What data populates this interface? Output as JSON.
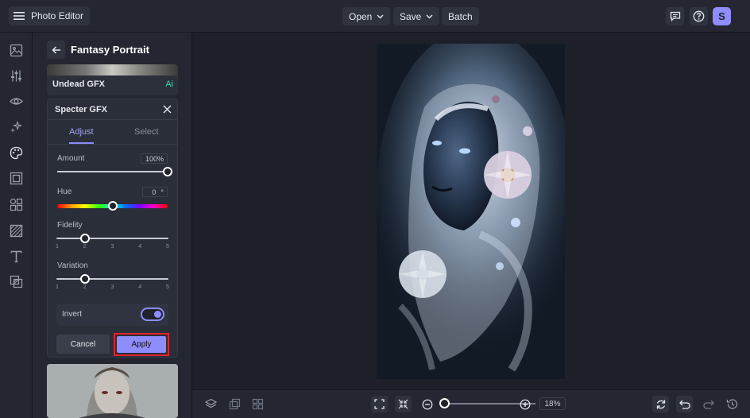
{
  "app": {
    "title": "Photo Editor",
    "user_initial": "S"
  },
  "toolbar": {
    "open_label": "Open",
    "save_label": "Save",
    "batch_label": "Batch"
  },
  "panel": {
    "title": "Fantasy Portrait",
    "undead": {
      "name": "Undead GFX",
      "ai_badge": "Ai"
    },
    "specter": {
      "title": "Specter GFX",
      "tabs": [
        {
          "label": "Adjust",
          "active": true
        },
        {
          "label": "Select",
          "active": false
        }
      ],
      "amount": {
        "label": "Amount",
        "value": "100%",
        "level": 1.0
      },
      "hue": {
        "label": "Hue",
        "value": "0",
        "unit": "°",
        "level": 0.5
      },
      "fidelity": {
        "label": "Fidelity",
        "ticks": [
          "1",
          "2",
          "3",
          "4",
          "5"
        ],
        "value": 2
      },
      "variation": {
        "label": "Variation",
        "ticks": [
          "1",
          "2",
          "3",
          "4",
          "5"
        ],
        "value": 2
      },
      "invert": {
        "label": "Invert",
        "on": true
      },
      "cancel_label": "Cancel",
      "apply_label": "Apply"
    }
  },
  "canvas": {
    "zoom": "18%",
    "zoom_level": 0.18
  },
  "colors": {
    "accent": "#8e8dfb",
    "highlight": "#e0242c",
    "ai_badge": "#47d3a6"
  }
}
